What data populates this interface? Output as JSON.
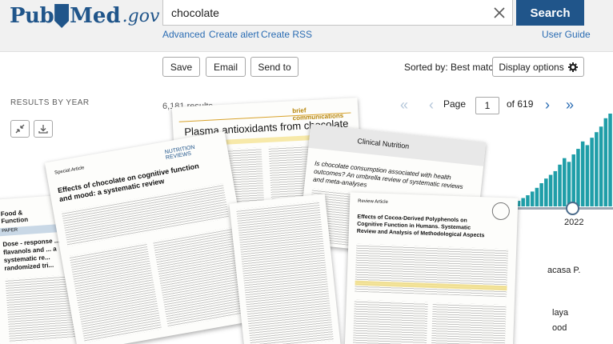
{
  "header": {
    "logo_pub": "Pub",
    "logo_med": "Med",
    "logo_gov": ".gov",
    "search_value": "chocolate",
    "search_button": "Search",
    "links": [
      "Advanced",
      "Create alert",
      "Create RSS"
    ],
    "user_guide": "User Guide"
  },
  "toolbar": {
    "save": "Save",
    "email": "Email",
    "send_to": "Send to",
    "sorted_by": "Sorted by: Best match",
    "display_options": "Display options"
  },
  "results": {
    "by_year_label": "RESULTS BY YEAR",
    "count": "6,181 results",
    "page_label": "Page",
    "page_value": "1",
    "page_total": "of 619",
    "year_end": "2022"
  },
  "histogram": {
    "values": [
      0.04,
      0.06,
      0.09,
      0.12,
      0.16,
      0.2,
      0.25,
      0.3,
      0.34,
      0.38,
      0.45,
      0.52,
      0.48,
      0.56,
      0.62,
      0.7,
      0.66,
      0.74,
      0.8,
      0.86,
      0.95,
      1.0
    ]
  },
  "side_fragments": [
    "acasa P.",
    "laya",
    "ood"
  ],
  "papers": {
    "plasma_title": "Plasma antioxidants from chocolate",
    "plasma_tag": "brief communications",
    "effects_title": "Effects of chocolate on cognitive function and mood: a systematic review",
    "effects_kicker": "Special Article",
    "food_title": "Food & Function",
    "food_paper": "PAPER",
    "food_subtitle": "Dose - response ... flavanols and ... a systematic re... randomized tri...",
    "clinical_journal": "Clinical Nutrition",
    "clinical_title": "Is chocolate consumption associated with health outcomes? An umbrella review of systematic reviews and meta-analyses",
    "cocoa_title": "Effects of Cocoa-Derived Polyphenols on Cognitive Function in Humans. Systematic Review and Analysis of Methodological Aspects",
    "cocoa_label": "Review Article"
  },
  "colors": {
    "brand": "#20558a",
    "link": "#2a6cb3",
    "histogram": "#1f9ea8"
  }
}
